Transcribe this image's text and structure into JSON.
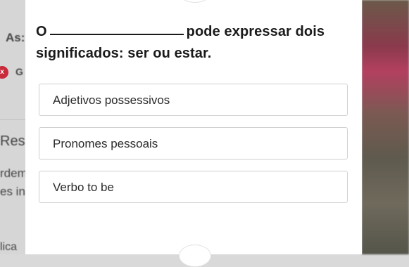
{
  "background": {
    "title_fragment": "As:",
    "badge_glyph": "x",
    "badge_letter": "G",
    "heading_fragment": "Res",
    "line1_fragment": "rdem",
    "line2_fragment": "es in",
    "line3_fragment": "lica"
  },
  "question": {
    "prefix": "O",
    "suffix": "pode expressar dois",
    "line2": "significados: ser ou estar."
  },
  "options": [
    {
      "label": "Adjetivos possessivos"
    },
    {
      "label": "Pronomes pessoais"
    },
    {
      "label": "Verbo to be"
    }
  ],
  "colors": {
    "badge": "#c82b3a",
    "modal_bg": "#ffffff",
    "option_border": "#cfcfcf"
  }
}
